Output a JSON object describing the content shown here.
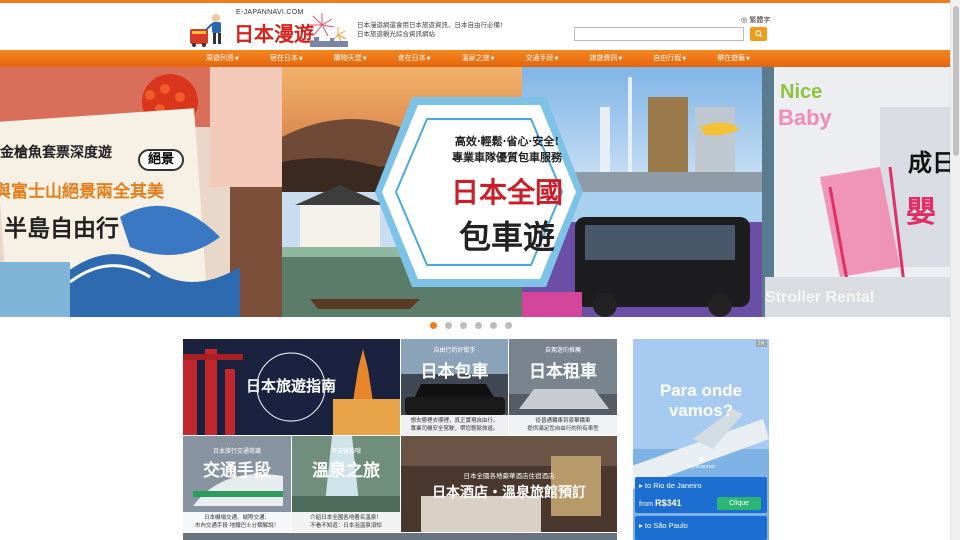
{
  "header": {
    "logo_sub": "E-JAPANNAVI.COM",
    "logo_main": "日本漫遊",
    "tagline_1": "日本漫遊網還會用日本旅遊資訊、日本自由行必備!",
    "tagline_2": "日本旅遊觀光綜合資訊網站",
    "language": "繁體字",
    "search_placeholder": ""
  },
  "nav": {
    "items": [
      {
        "label": "周遊列島"
      },
      {
        "label": "宿在日本"
      },
      {
        "label": "購物天堂"
      },
      {
        "label": "食在日本"
      },
      {
        "label": "溫泉之旅"
      },
      {
        "label": "交通手段"
      },
      {
        "label": "旅遊資訊"
      },
      {
        "label": "自由行程"
      },
      {
        "label": "樂在遊藝"
      }
    ]
  },
  "hero": {
    "left_line1": "金槍魚套票深度遊",
    "left_badge": "絕景",
    "left_line2": "與富士山絕景兩全其美",
    "left_line3": "半島自由行",
    "center_tagline1": "高效·輕鬆·省心·安全!",
    "center_tagline2": "專業車隊優質包車服務",
    "center_title1": "日本全國",
    "center_title2": "包車遊",
    "right_brand1": "Nice",
    "right_brand2": "Baby",
    "right_title1": "成日",
    "right_title2": "嬰",
    "right_footer": "Stroller Rental"
  },
  "carousel": {
    "count": 6,
    "active": 0
  },
  "tiles": {
    "guide": "日本旅遊指南",
    "car_sub": "自由行的好幫手",
    "car_title": "日本包車",
    "car_cap1": "想去哪裡去哪裡，真正實現自由行。",
    "car_cap2": "專業司機安全駕駛，帶您輕鬆旅遊。",
    "rent_sub": "自駕遊的推薦",
    "rent_title": "日本租車",
    "rent_cap1": "從普通轎車到豪華轎車",
    "rent_cap2": "提供滿足您自由行的所有車型",
    "transport_sub": "日本旅行交通常識",
    "transport_title": "交通手段",
    "transport_cap1": "日本機場交通、城際交通、",
    "transport_cap2": "市內交通手段 地鐵巴士分類解說！",
    "onsen_sub": "不去後悔哦",
    "onsen_title": "溫泉之旅",
    "onsen_cap1": "介紹日本全國各地著名溫泉！",
    "onsen_cap2": "不看不知道：日本泡溫泉須知",
    "hotel_sub": "日本全國各地豪華酒店住宿酒店",
    "hotel_title": "日本酒店・溫泉旅館預訂"
  },
  "ad": {
    "headline1": "Para onde",
    "headline2": "vamos?",
    "brand": "Skyscanner",
    "dest1": "to Rio de Janeiro",
    "from_label": "from",
    "price": "R$341",
    "cta": "Clique",
    "dest2": "to São Paulo"
  },
  "colors": {
    "accent": "#f07a1c",
    "nav": "#ec7216",
    "logo_red": "#d5231b"
  }
}
